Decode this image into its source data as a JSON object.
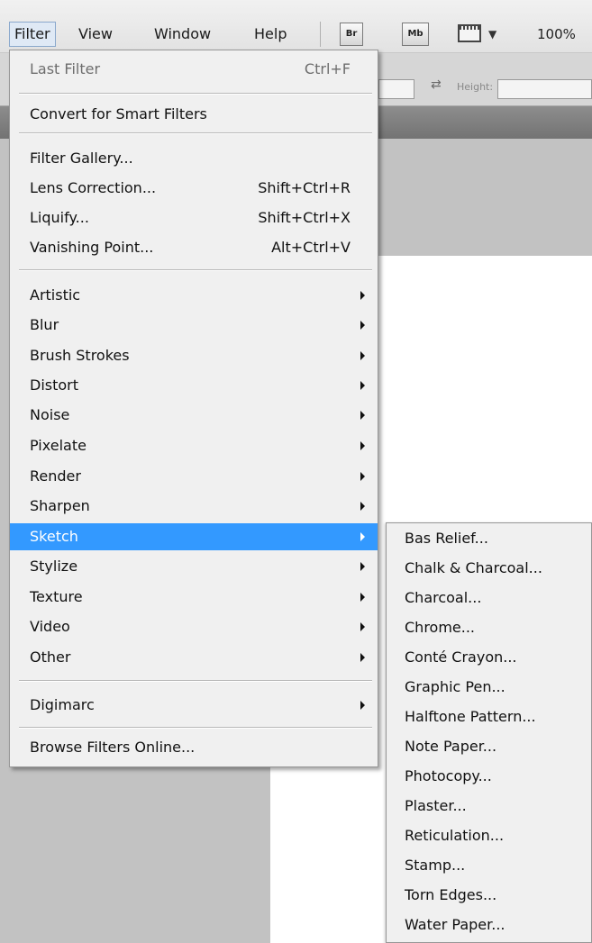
{
  "menubar": {
    "items": [
      "Filter",
      "View",
      "Window",
      "Help"
    ],
    "buttons": {
      "bridge": "Br",
      "mini_bridge": "Mb"
    },
    "zoom": "100%"
  },
  "options_bar": {
    "height_label": "Height:"
  },
  "filter_menu": {
    "last_filter": {
      "label": "Last Filter",
      "shortcut": "Ctrl+F",
      "enabled": false
    },
    "smart_filters": {
      "label": "Convert for Smart Filters"
    },
    "filter_gallery": {
      "label": "Filter Gallery..."
    },
    "lens_correction": {
      "label": "Lens Correction...",
      "shortcut": "Shift+Ctrl+R"
    },
    "liquify": {
      "label": "Liquify...",
      "shortcut": "Shift+Ctrl+X"
    },
    "vanishing_point": {
      "label": "Vanishing Point...",
      "shortcut": "Alt+Ctrl+V"
    },
    "submenus": [
      "Artistic",
      "Blur",
      "Brush Strokes",
      "Distort",
      "Noise",
      "Pixelate",
      "Render",
      "Sharpen",
      "Sketch",
      "Stylize",
      "Texture",
      "Video",
      "Other"
    ],
    "highlighted": "Sketch",
    "digimarc": {
      "label": "Digimarc"
    },
    "browse_online": {
      "label": "Browse Filters Online..."
    }
  },
  "sketch_submenu": {
    "items": [
      "Bas Relief...",
      "Chalk & Charcoal...",
      "Charcoal...",
      "Chrome...",
      "Conté Crayon...",
      "Graphic Pen...",
      "Halftone Pattern...",
      "Note Paper...",
      "Photocopy...",
      "Plaster...",
      "Reticulation...",
      "Stamp...",
      "Torn Edges...",
      "Water Paper..."
    ]
  },
  "colors": {
    "highlight": "#3399ff",
    "menu_bg": "#f0f0f0",
    "workspace": "#c2c2c2"
  }
}
